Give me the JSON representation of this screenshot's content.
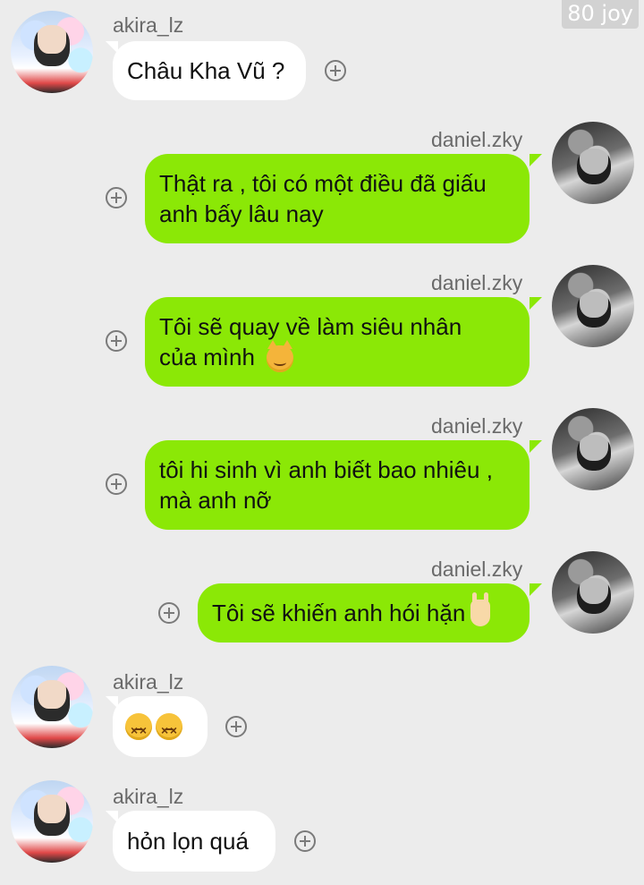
{
  "watermark": "80 joy",
  "messages": [
    {
      "sender": "akira_lz",
      "side": "in",
      "text": "Châu Kha Vũ ?"
    },
    {
      "sender": "daniel.zky",
      "side": "out",
      "line1": "Thật ra , tôi có một điều đã giấu",
      "line2": "anh bấy lâu nay"
    },
    {
      "sender": "daniel.zky",
      "side": "out",
      "line1": "Tôi sẽ quay về làm siêu nhân",
      "line2": "của mình",
      "emoji": "smirking-cat-emoji"
    },
    {
      "sender": "daniel.zky",
      "side": "out",
      "line1": "tôi hi sinh vì anh biết bao nhiêu ,",
      "line2": "mà anh nỡ"
    },
    {
      "sender": "daniel.zky",
      "side": "out",
      "text": "Tôi sẽ khiến anh hói hặn",
      "emoji": "sign-of-horns-emoji"
    },
    {
      "sender": "akira_lz",
      "side": "in",
      "emoji": "confounded-face-emoji x2"
    },
    {
      "sender": "akira_lz",
      "side": "in",
      "text": "hỏn lọn quá"
    }
  ]
}
